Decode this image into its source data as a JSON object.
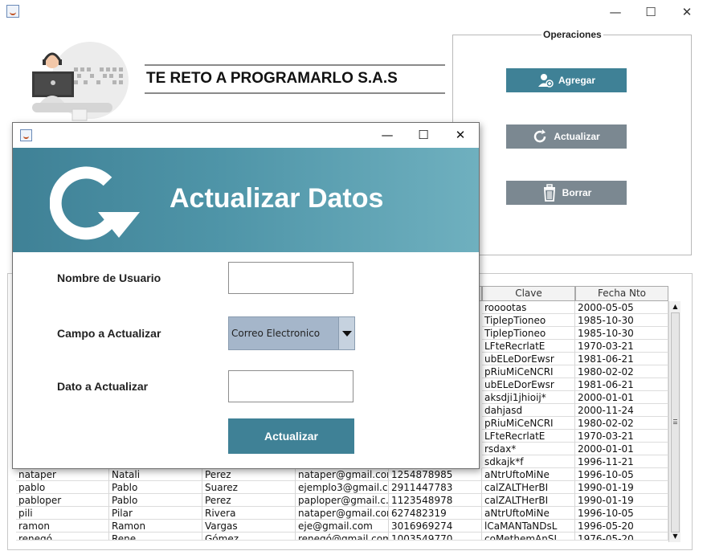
{
  "main_window": {
    "controls": {
      "minimize": "—",
      "maximize": "☐",
      "close": "✕"
    }
  },
  "header": {
    "company_title": "TE RETO A PROGRAMARLO S.A.S"
  },
  "operations": {
    "title": "Operaciones",
    "buttons": [
      {
        "label": "Agregar",
        "icon": "add-user-icon",
        "color": "#3f8196"
      },
      {
        "label": "Actualizar",
        "icon": "refresh-icon",
        "color": "#7b8891"
      },
      {
        "label": "Borrar",
        "icon": "trash-icon",
        "color": "#7b8891"
      }
    ]
  },
  "table": {
    "visible_headers": [
      "Clave",
      "Fecha Nto"
    ],
    "top_rows": [
      [
        "rooootas",
        "2000-05-05"
      ],
      [
        "TiplepTioneo",
        "1985-10-30"
      ],
      [
        "TiplepTioneo",
        "1985-10-30"
      ],
      [
        "LFteRecrlatE",
        "1970-03-21"
      ],
      [
        "ubELeDorEwsr",
        "1981-06-21"
      ],
      [
        "pRiuMiCeNCRI",
        "1980-02-02"
      ],
      [
        "ubELeDorEwsr",
        "1981-06-21"
      ],
      [
        "aksdji1jhioij*",
        "2000-01-01"
      ],
      [
        "dahjasd",
        "2000-11-24"
      ],
      [
        "pRiuMiCeNCRI",
        "1980-02-02"
      ],
      [
        "LFteRecrlatE",
        "1970-03-21"
      ],
      [
        "rsdax*",
        "2000-01-01"
      ],
      [
        "sdkajk*f",
        "1996-11-21"
      ]
    ],
    "bottom_rows": [
      [
        "nataper",
        "Natali",
        "Perez",
        "nataper@gmail.com",
        "1254878985",
        "aNtrUftoMiNe",
        "1996-10-05"
      ],
      [
        "pablo",
        "Pablo",
        "Suarez",
        "ejemplo3@gmail.c...",
        "2911447783",
        "calZALTHerBI",
        "1990-01-19"
      ],
      [
        "pabloper",
        "Pablo",
        "Perez",
        "paploper@gmail.c...",
        "1123548978",
        "calZALTHerBI",
        "1990-01-19"
      ],
      [
        "pili",
        "Pilar",
        "Rivera",
        "nataper@gmail.com",
        "627482319",
        "aNtrUftoMiNe",
        "1996-10-05"
      ],
      [
        "ramon",
        "Ramon",
        "Vargas",
        "eje@gmail.com",
        "3016969274",
        "lCaMANTaNDsL",
        "1996-05-20"
      ],
      [
        "renegó",
        "Rene",
        "Gómez",
        "renegó@gmail.com",
        "1003549770",
        "coMethemAnSL",
        "1976-05-20"
      ]
    ]
  },
  "dialog": {
    "controls": {
      "minimize": "—",
      "maximize": "☐",
      "close": "✕"
    },
    "banner_title": "Actualizar Datos",
    "banner_icon": "refresh-icon",
    "fields": {
      "username_label": "Nombre de Usuario",
      "username_value": "",
      "field_label": "Campo a Actualizar",
      "field_selected": "Correo Electronico",
      "data_label": "Dato a Actualizar",
      "data_value": ""
    },
    "submit_label": "Actualizar"
  }
}
